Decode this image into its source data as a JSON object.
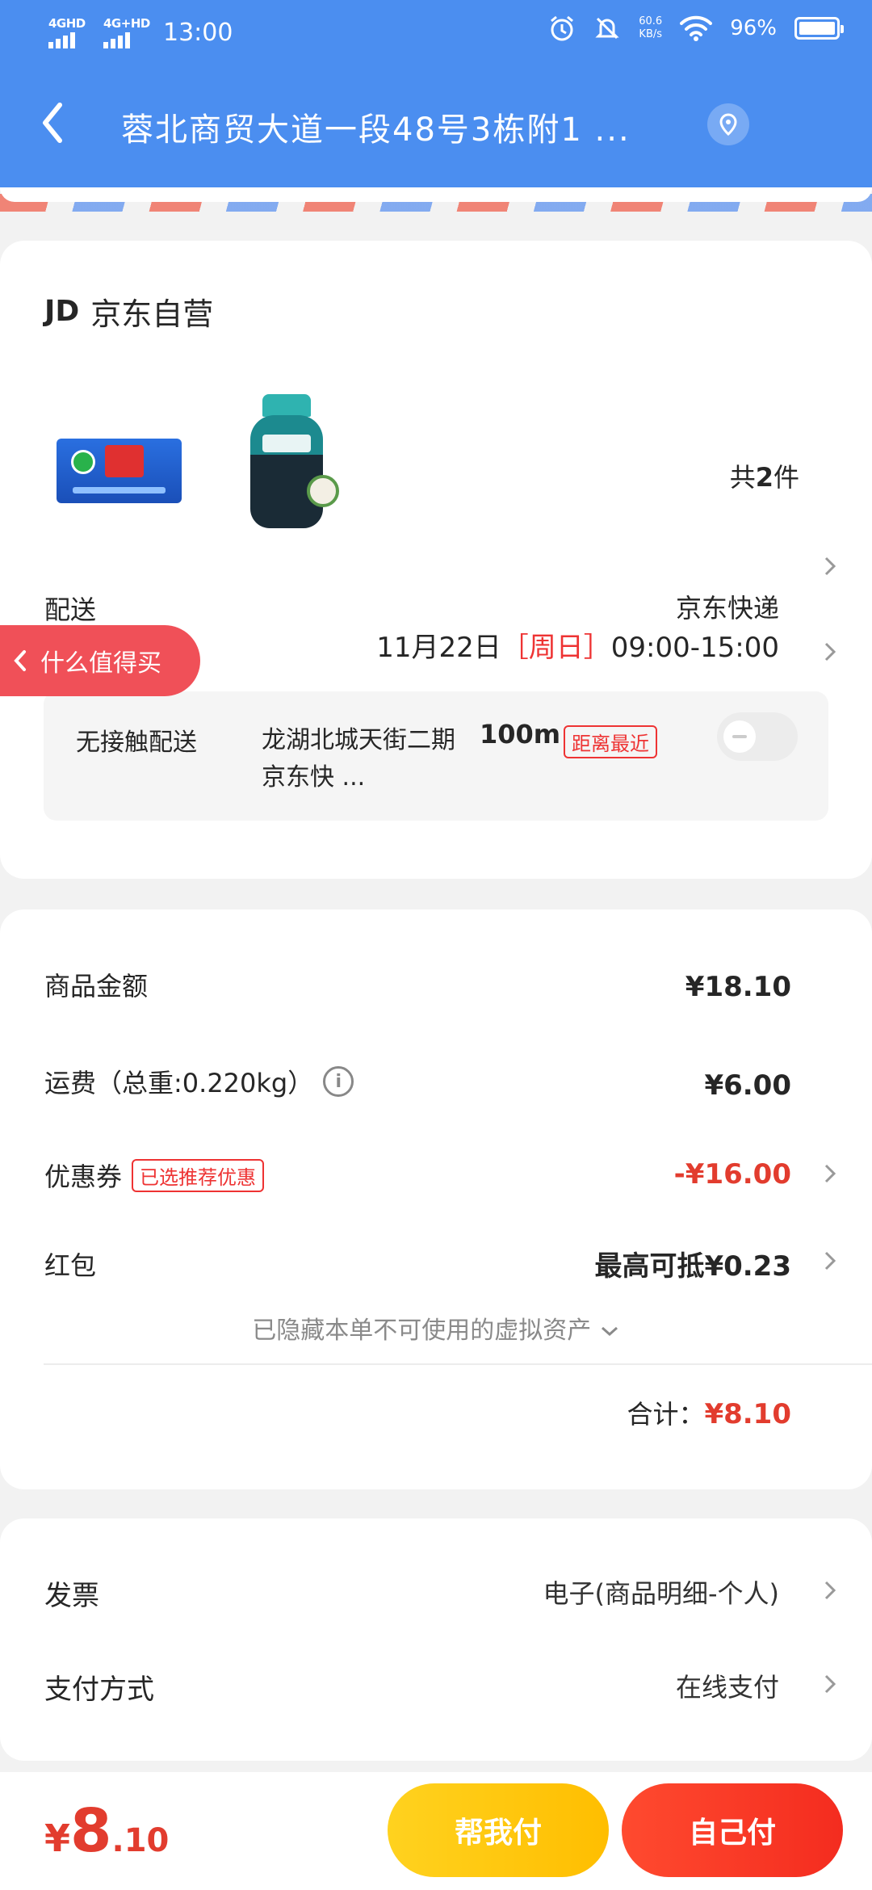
{
  "status": {
    "net1": "4GHD",
    "net2": "4G+HD",
    "time": "13:00",
    "speed_value": "60.6",
    "speed_unit": "KB/s",
    "battery": "96%"
  },
  "header": {
    "address": "蓉北商贸大道一段48号3栋附1 ...",
    "icons": [
      "back-chevron",
      "location-pin"
    ]
  },
  "order": {
    "shop_logo": "JD",
    "shop_name": "京东自营",
    "count_prefix": "共",
    "count_num": "2",
    "count_suffix": "件",
    "delivery_label": "配送",
    "carrier": "京东快递",
    "date": "11月22日",
    "weekday": "［周日］",
    "time_range": "09:00-15:00",
    "contactless_label": "无接触配送",
    "pickup_name": "龙湖北城天街二期京东快 ...",
    "distance": "100m",
    "nearest_badge": "距离最近"
  },
  "floating": {
    "worth_buy": "什么值得买"
  },
  "costs": {
    "goods_label": "商品金额",
    "goods_value": "¥18.10",
    "shipping_label": "运费（总重:0.220kg）",
    "shipping_value": "¥6.00",
    "coupon_label": "优惠券",
    "coupon_badge": "已选推荐优惠",
    "coupon_value": "-¥16.00",
    "redpack_label": "红包",
    "redpack_value": "最高可抵¥0.23",
    "hidden_assets": "已隐藏本单不可使用的虚拟资产",
    "total_label": "合计：",
    "total_value": "¥8.10"
  },
  "extra": {
    "invoice_label": "发票",
    "invoice_value": "电子(商品明细-个人)",
    "payment_label": "支付方式",
    "payment_value": "在线支付"
  },
  "bottom": {
    "currency": "¥",
    "price_int": "8",
    "price_dec": ".10",
    "help_pay": "帮我付",
    "self_pay": "自己付"
  },
  "colors": {
    "header_bg": "#4b8ef0",
    "accent_red": "#e23c2e",
    "help_btn": "#ffc20a",
    "self_btn": "#f53a24"
  }
}
